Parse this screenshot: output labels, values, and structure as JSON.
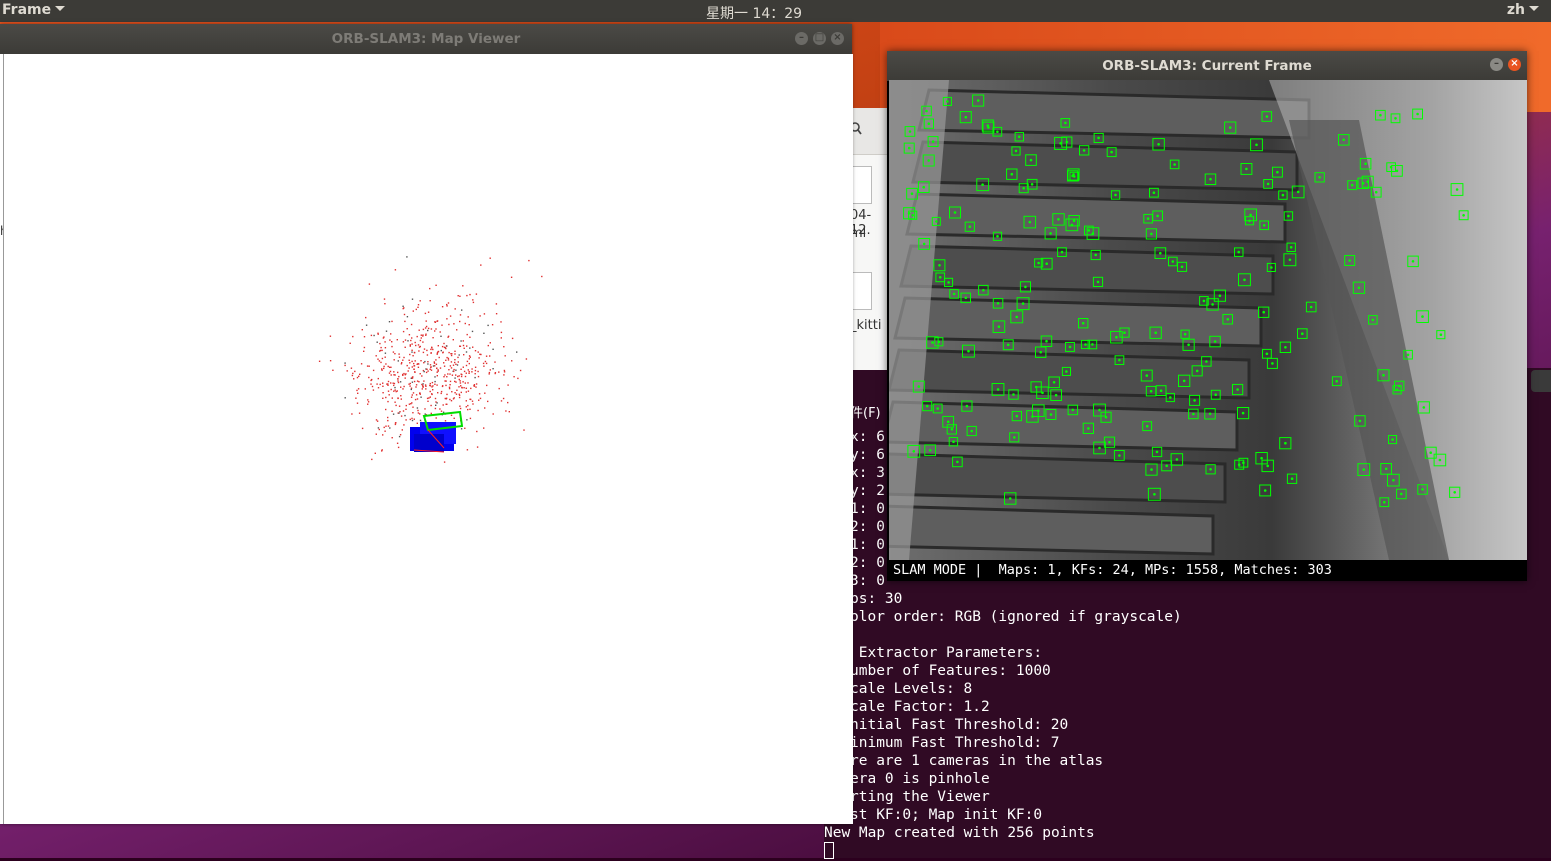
{
  "topbar": {
    "app_menu": "Frame",
    "clock": "星期一 14：29",
    "user_menu": "zh"
  },
  "map_viewer": {
    "title": "ORB-SLAM3: Map Viewer",
    "side_label": "h",
    "colors": {
      "map_points": "#e03030",
      "keyframe_current": "#00dd00",
      "keyframes": "#0000ff"
    }
  },
  "current_frame": {
    "title": "ORB-SLAM3: Current Frame",
    "status": "SLAM MODE |  Maps: 1, KFs: 24, MPs: 1558, Matches: 303",
    "feature_color": "#00ff00"
  },
  "file_manager": {
    "file1_label_a": "04-12.",
    "file1_label_b": "ml",
    "file2_label": "_kitti"
  },
  "terminal": {
    "menu_fragment": "件(F)",
    "lines": [
      "x: 6",
      "y: 6",
      "x: 3",
      "y: 2",
      "1: 0",
      "2: 0",
      "1: 0",
      "2: 0",
      "3: 0",
      "ps: 30",
      "olor order: RGB (ignored if grayscale)",
      "",
      " Extractor Parameters:",
      "umber of Features: 1000",
      "cale Levels: 8",
      "cale Factor: 1.2",
      "nitial Fast Threshold: 20",
      "inimum Fast Threshold: 7",
      "re are 1 cameras in the atlas",
      "era 0 is pinhole",
      "rting the Viewer",
      "st KF:0; Map init KF:0",
      "New Map created with 256 points"
    ]
  }
}
